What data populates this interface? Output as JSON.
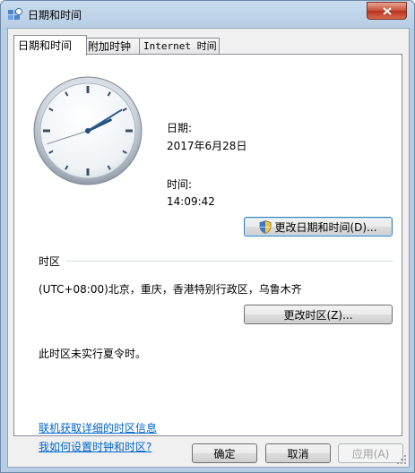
{
  "window": {
    "title": "日期和时间"
  },
  "tabs": [
    {
      "label": "日期和时间"
    },
    {
      "label": "附加时钟"
    },
    {
      "label": "Internet 时间"
    }
  ],
  "datetime": {
    "date_label": "日期:",
    "date_value": "2017年6月28日",
    "time_label": "时间:",
    "time_value": "14:09:42",
    "change_button": "更改日期和时间(D)..."
  },
  "clock": {
    "hour": 14,
    "minute": 9,
    "second": 42
  },
  "timezone": {
    "section_label": "时区",
    "value": "(UTC+08:00)北京，重庆，香港特别行政区，乌鲁木齐",
    "change_button": "更改时区(Z)...",
    "dst_note": "此时区未实行夏令时。"
  },
  "links": {
    "online_info": "联机获取详细的时区信息",
    "how_to": "我如何设置时钟和时区?"
  },
  "footer": {
    "ok": "确定",
    "cancel": "取消",
    "apply": "应用(A)"
  },
  "colors": {
    "link": "#0066cc",
    "close_button": "#c75039"
  }
}
